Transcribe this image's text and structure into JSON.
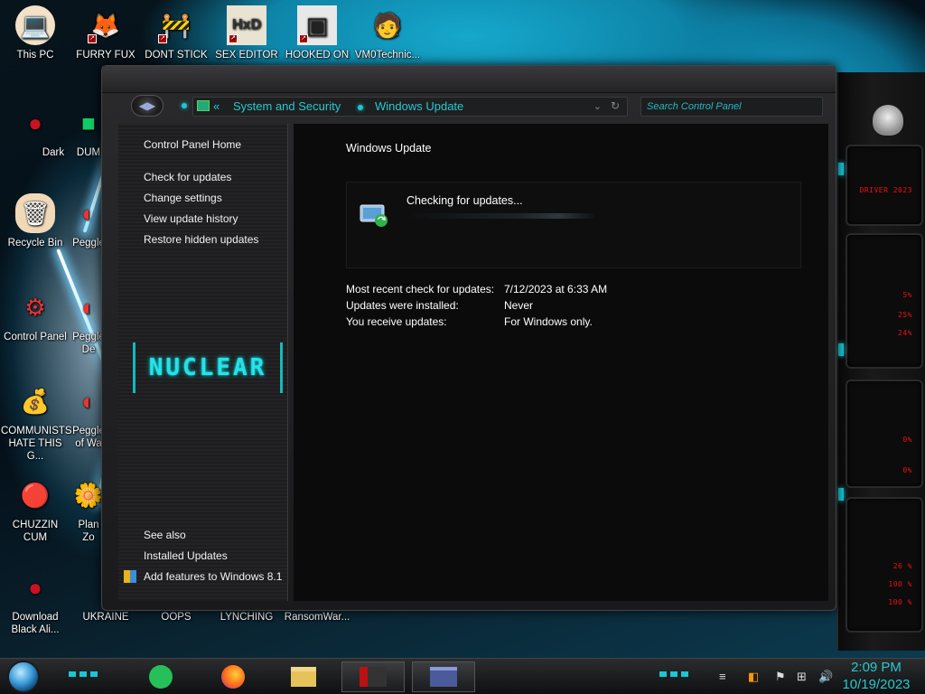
{
  "desktop": {
    "icons": [
      {
        "label": "This PC",
        "glyph": "💻"
      },
      {
        "label": "FURRY FUX",
        "glyph": "🦊"
      },
      {
        "label": "DONT STICK",
        "glyph": "🚧"
      },
      {
        "label": "SEX EDITOR",
        "glyph": "HxD"
      },
      {
        "label": "HOOKED ON",
        "glyph": "▣"
      },
      {
        "label": "VM0Technic...",
        "glyph": "🧑"
      },
      {
        "label": "Dark",
        "glyph": "●"
      },
      {
        "label": "DUM",
        "glyph": "■"
      },
      {
        "label": "Recycle Bin",
        "glyph": "🗑"
      },
      {
        "label": "Peggle",
        "glyph": "◐"
      },
      {
        "label": "Control Panel",
        "glyph": "⚙"
      },
      {
        "label": "Peggle De",
        "glyph": "◐"
      },
      {
        "label": "COMMUNISTS HATE THIS G...",
        "glyph": "💰"
      },
      {
        "label": "Peggle of Wa",
        "glyph": "◐"
      },
      {
        "label": "CHUZZIN CUM",
        "glyph": "🔴"
      },
      {
        "label": "Plan Zo",
        "glyph": "🌼"
      },
      {
        "label": "Download Black Ali...",
        "glyph": "●"
      },
      {
        "label": "UKRAINE",
        "glyph": ""
      },
      {
        "label": "OOPS",
        "glyph": ""
      },
      {
        "label": "LYNCHING",
        "glyph": ""
      },
      {
        "label": "RansomWar...",
        "glyph": ""
      }
    ]
  },
  "gadget": {
    "lines": [
      "DRIVER 2023",
      "5%",
      "25%",
      "24%",
      "0%",
      "0%",
      "26 %",
      "100 %",
      "100 %"
    ]
  },
  "window": {
    "address": {
      "back": "«",
      "crumb1": "System and Security",
      "crumb2": "Windows Update"
    },
    "search": {
      "placeholder": "Search Control Panel"
    },
    "sidebar": {
      "home": "Control Panel Home",
      "links": [
        "Check for updates",
        "Change settings",
        "View update history",
        "Restore hidden updates"
      ],
      "logo": "NUCLEAR",
      "see_also": "See also",
      "see_also_links": [
        "Installed Updates",
        "Add features to Windows 8.1"
      ]
    },
    "content": {
      "title": "Windows Update",
      "status": "Checking for updates...",
      "info": [
        {
          "label": "Most recent check for updates:",
          "value": "7/12/2023 at 6:33 AM"
        },
        {
          "label": "Updates were installed:",
          "value": "Never"
        },
        {
          "label": "You receive updates:",
          "value": "For Windows only."
        }
      ]
    }
  },
  "taskbar": {
    "time": "2:09 PM",
    "date": "10/19/2023"
  },
  "colors": {
    "accent": "#25c9d1",
    "alert_red": "#e11111"
  }
}
